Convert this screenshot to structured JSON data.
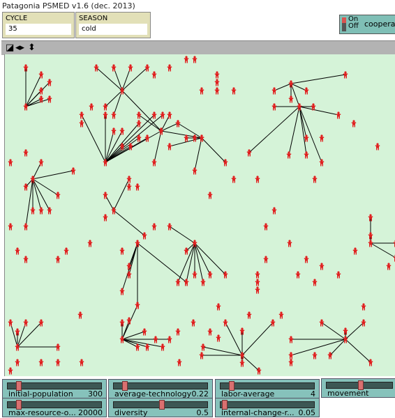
{
  "title": "Patagonia PSMED v1.6 (dec. 2013)",
  "monitors": [
    {
      "label": "CYCLE",
      "value": "35"
    },
    {
      "label": "SEASON",
      "value": "cold"
    }
  ],
  "switch": {
    "on_label": "On",
    "off_label": "Off",
    "name": "coopera",
    "state": "on"
  },
  "view_controls": {
    "icons": [
      "resize-icon",
      "horizontal-arrows-icon",
      "vertical-arrows-icon"
    ]
  },
  "colors": {
    "world_bg": "#d5f3d8",
    "agent": "#e02020",
    "link": "#000000",
    "slider": "#86c2bb"
  },
  "sliders": [
    {
      "name": "initial-population",
      "value": "300",
      "level": 0.1
    },
    {
      "name": "average-technology",
      "value": "0.22",
      "level": 0.1
    },
    {
      "name": "labor-average",
      "value": "4",
      "level": 0.1
    },
    {
      "name": "movement",
      "value": "",
      "level": 0.5
    },
    {
      "name": "max-resource-o...",
      "value": "20000",
      "level": 0.1
    },
    {
      "name": "diversity",
      "value": "0.5",
      "level": 0.5
    },
    {
      "name": "internal-change-r...",
      "value": "0.05",
      "level": 0.02
    }
  ]
}
